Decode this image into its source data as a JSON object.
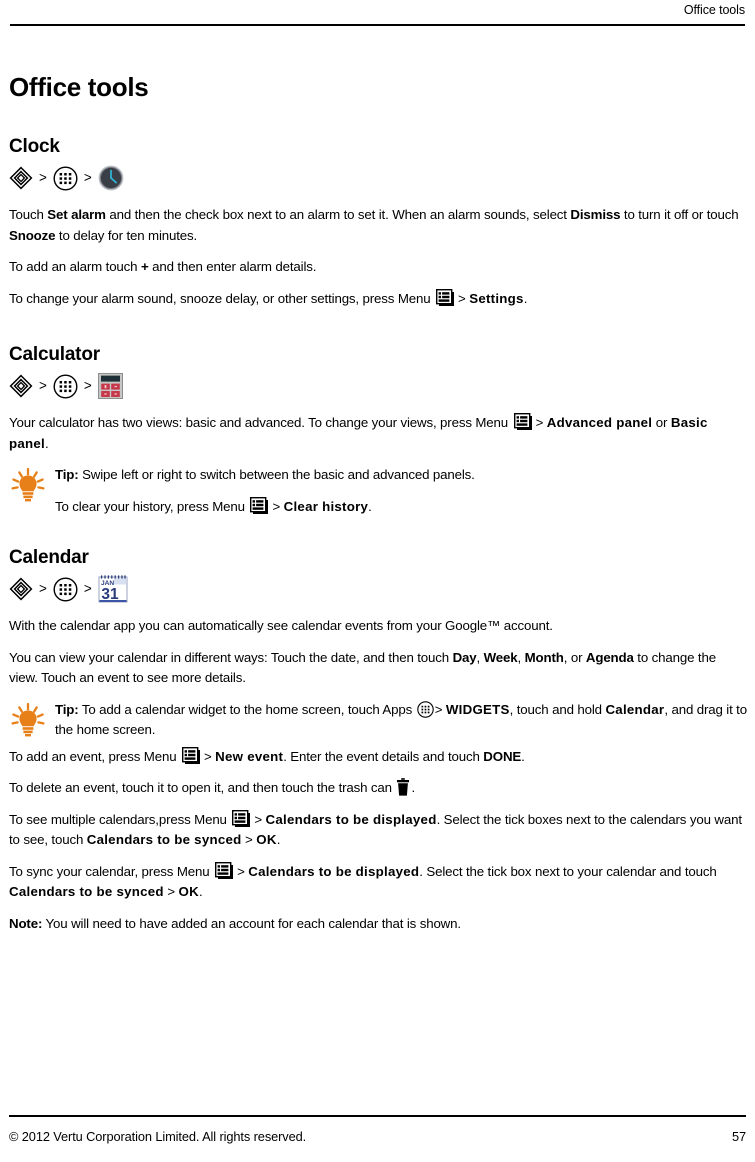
{
  "header": {
    "running_head": "Office tools"
  },
  "doc": {
    "title": "Office tools"
  },
  "sections": {
    "clock": {
      "title": "Clock",
      "path": {
        "home_icon": "home-diamond-icon",
        "sep1": ">",
        "apps_icon": "apps-grid-icon",
        "sep2": ">",
        "app_icon": "clock-icon"
      },
      "p1_a": "Touch ",
      "p1_b": "Set alarm",
      "p1_c": " and then the check box next to an alarm to set it. When an alarm sounds, select ",
      "p1_d": "Dismiss",
      "p1_e": " to turn it off or touch ",
      "p1_f": "Snooze",
      "p1_g": " to delay for ten minutes.",
      "p2_a": "To add an alarm touch ",
      "p2_b": "+",
      "p2_c": " and then enter alarm details.",
      "p3_a": "To change your alarm sound, snooze delay, or other settings, press Menu ",
      "p3_b": ">",
      "p3_c": "Settings",
      "p3_d": "."
    },
    "calculator": {
      "title": "Calculator",
      "path": {
        "home_icon": "home-diamond-icon",
        "sep1": ">",
        "apps_icon": "apps-grid-icon",
        "sep2": ">",
        "app_icon": "calculator-icon"
      },
      "p1_a": "Your calculator has two views: basic and advanced. To change your views, press Menu ",
      "p1_b": ">",
      "p1_c": "Advanced panel",
      "p1_d": " or ",
      "p1_e": "Basic panel",
      "p1_f": ".",
      "tip_label": "Tip:",
      "tip_text": " Swipe left or right to switch between the basic and advanced panels.",
      "tip_p2_a": "To clear your history, press Menu ",
      "tip_p2_b": ">",
      "tip_p2_c": "Clear history",
      "tip_p2_d": "."
    },
    "calendar": {
      "title": "Calendar",
      "path": {
        "home_icon": "home-diamond-icon",
        "sep1": ">",
        "apps_icon": "apps-grid-icon",
        "sep2": ">",
        "app_icon": "calendar-icon"
      },
      "calendar_icon_month": "JAN",
      "calendar_icon_day": "31",
      "p1": "With the calendar app you can automatically see calendar events from your Google™ account.",
      "p2_a": "You can view your calendar in different ways: Touch the date, and then touch ",
      "p2_b": "Day",
      "p2_c": ", ",
      "p2_d": "Week",
      "p2_e": ", ",
      "p2_f": "Month",
      "p2_g": ", or ",
      "p2_h": "Agenda",
      "p2_i": " to change the view. Touch an event to see more details.",
      "tip_label": "Tip:",
      "tip_a": " To add a calendar widget to the home screen, touch Apps ",
      "tip_b": ">",
      "tip_c": "WIDGETS",
      "tip_d": ", touch and hold ",
      "tip_e": "Calendar",
      "tip_f": ", and drag it to the home screen.",
      "p3_a": "To add an event, press Menu ",
      "p3_b": ">",
      "p3_c": "New event",
      "p3_d": ". Enter the event details and touch ",
      "p3_e": "DONE",
      "p3_f": ".",
      "p4_a": "To delete an event, touch it to open it, and then touch the trash can ",
      "p4_b": ".",
      "p5_a": "To see multiple calendars,press Menu ",
      "p5_b": ">",
      "p5_c": "Calendars to be displayed",
      "p5_d": ". Select the tick boxes next to the calendars you want to see, touch ",
      "p5_e": "Calendars to be synced",
      "p5_f": " > ",
      "p5_g": "OK",
      "p5_h": ".",
      "p6_a": "To sync your calendar, press Menu ",
      "p6_b": ">",
      "p6_c": "Calendars to be displayed",
      "p6_d": ". Select the tick box next to your calendar and touch ",
      "p6_e": "Calendars to be synced",
      "p6_f": " > ",
      "p6_g": "OK",
      "p6_h": ".",
      "note_label": "Note:",
      "note_text": " You will need to have added an account for each calendar that is shown."
    }
  },
  "footer": {
    "copyright": "© 2012 Vertu Corporation Limited. All rights reserved.",
    "page_number": "57"
  },
  "colors": {
    "text": "#000000",
    "tip_orange": "#E8801A",
    "clock_face": "#3A3F47",
    "clock_hands": "#2FB8D8",
    "calc_body": "#BFBFBF",
    "calc_screen": "#1E3036",
    "calc_button": "#C4384A",
    "calendar_navy": "#283A7A"
  }
}
